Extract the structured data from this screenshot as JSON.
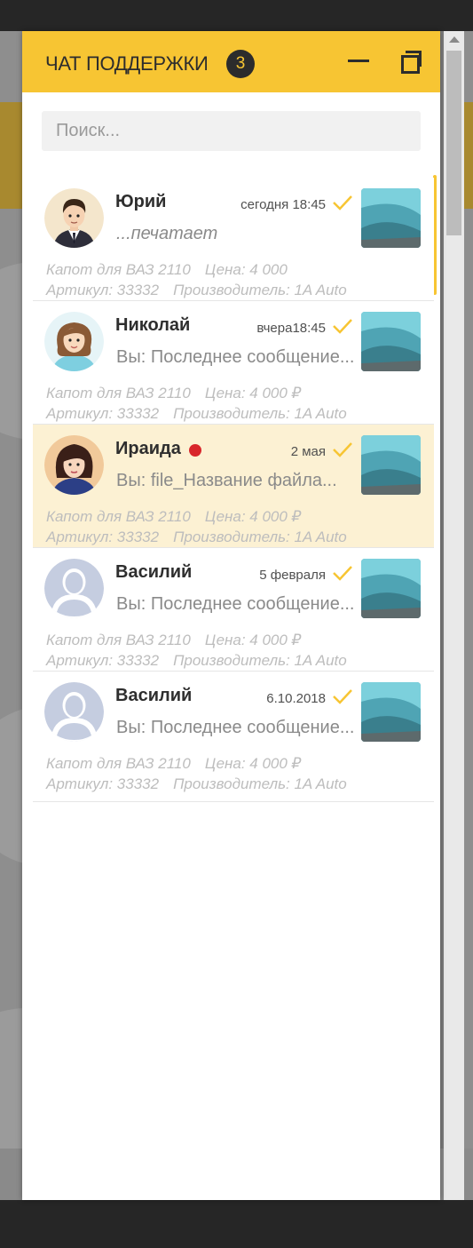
{
  "header": {
    "title": "ЧАТ ПОДДЕРЖКИ",
    "badge_count": "3",
    "minimize_icon": "minimize-icon",
    "restore_icon": "restore-window-icon"
  },
  "search": {
    "placeholder": "Поиск..."
  },
  "colors": {
    "accent": "#f7c533",
    "active_row": "#fcf1d3",
    "unread_dot": "#d8262b",
    "meta_text": "#bdbdbd"
  },
  "chats": [
    {
      "name": "Юрий",
      "time": "сегодня 18:45",
      "preview": "...печатает",
      "product": "Капот для ВАЗ 2110",
      "price": "Цена: 4 000",
      "article": "Артикул: 33332",
      "maker": "Производитель: 1A Auto",
      "avatar": "avatar-man-icon",
      "read_status": "check-icon"
    },
    {
      "name": "Николай",
      "time": "вчера18:45",
      "preview": "Вы: Последнее сообщение...",
      "product": "Капот для ВАЗ 2110",
      "price": "Цена: 4 000 ₽",
      "article": "Артикул: 33332",
      "maker": "Производитель: 1A Auto",
      "avatar": "avatar-woman-icon",
      "read_status": "check-icon"
    },
    {
      "name": "Ираида",
      "time": "2 мая",
      "preview": "Вы: file_Название файла...",
      "product": "Капот для ВАЗ 2110",
      "price": "Цена: 4 000 ₽",
      "article": "Артикул: 33332",
      "maker": "Производитель: 1A Auto",
      "avatar": "avatar-woman-icon",
      "read_status": "check-icon",
      "unread": true
    },
    {
      "name": "Василий",
      "time": "5 февраля",
      "preview": "Вы: Последнее сообщение...",
      "product": "Капот для ВАЗ 2110",
      "price": "Цена: 4 000 ₽",
      "article": "Артикул: 33332",
      "maker": "Производитель: 1A Auto",
      "avatar": "avatar-placeholder-icon",
      "read_status": "check-icon"
    },
    {
      "name": "Василий",
      "time": "6.10.2018",
      "preview": "Вы: Последнее сообщение...",
      "product": "Капот для ВАЗ 2110",
      "price": "Цена: 4 000 ₽",
      "article": "Артикул: 33332",
      "maker": "Производитель: 1A Auto",
      "avatar": "avatar-placeholder-icon",
      "read_status": "check-icon"
    }
  ]
}
